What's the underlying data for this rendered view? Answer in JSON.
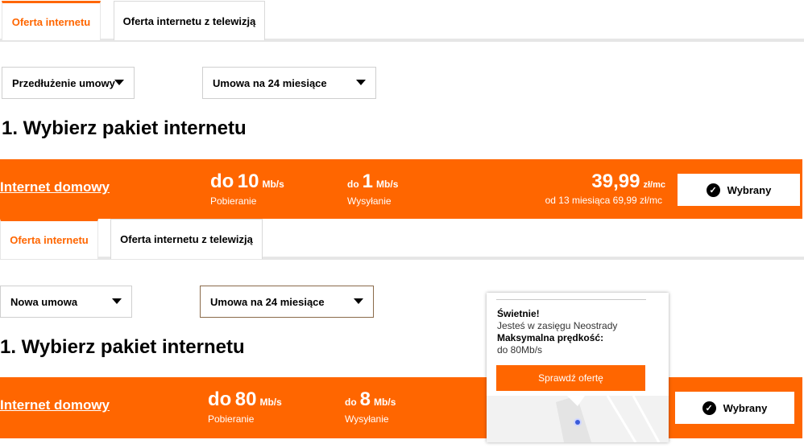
{
  "top": {
    "tabs": [
      {
        "label": "Oferta internetu"
      },
      {
        "label": "Oferta internetu z telewizją"
      }
    ],
    "select_type": {
      "value": "Przedłużenie umowy"
    },
    "select_term": {
      "value": "Umowa na 24 miesiące"
    },
    "heading": "1. Wybierz pakiet internetu",
    "package": {
      "name": "Internet domowy",
      "download_pre": "do",
      "download_value": "10",
      "download_unit": "Mb/s",
      "download_label": "Pobieranie",
      "upload_pre": "do",
      "upload_value": "1",
      "upload_unit": "Mb/s",
      "upload_label": "Wysyłanie",
      "price": "39,99",
      "price_unit": "zł/mc",
      "price_note": "od 13 miesiąca 69,99 zł/mc",
      "button_label": "Wybrany"
    }
  },
  "bottom": {
    "tabs": [
      {
        "label": "Oferta internetu"
      },
      {
        "label": "Oferta internetu z telewizją"
      }
    ],
    "select_type": {
      "value": "Nowa umowa"
    },
    "select_term": {
      "value": "Umowa na 24 miesiące"
    },
    "heading": "1. Wybierz pakiet internetu",
    "package": {
      "name": "Internet domowy",
      "download_pre": "do",
      "download_value": "80",
      "download_unit": "Mb/s",
      "download_label": "Pobieranie",
      "upload_pre": "do",
      "upload_value": "8",
      "upload_unit": "Mb/s",
      "upload_label": "Wysyłanie",
      "button_label": "Wybrany"
    },
    "popup": {
      "title": "Świetnie!",
      "line1": "Jesteś w zasięgu Neostrady",
      "speed_label": "Maksymalna prędkość:",
      "speed_value": "do 80Mb/s",
      "button_label": "Sprawdź ofertę"
    }
  },
  "colors": {
    "accent": "#ff6600",
    "text": "#000000",
    "white": "#ffffff"
  },
  "icons": {
    "check": "check-circle-icon",
    "caret": "caret-down-icon",
    "pin": "map-pin-icon"
  }
}
